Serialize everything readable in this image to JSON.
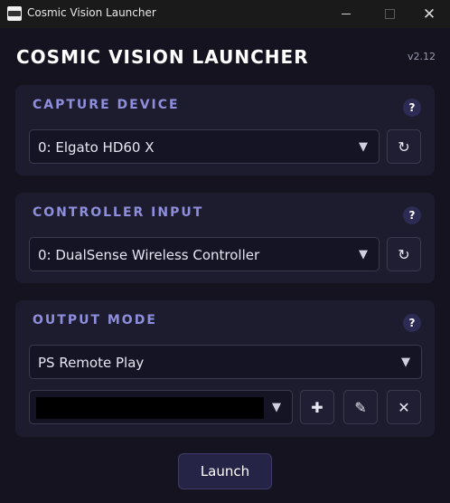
{
  "window": {
    "title": "Cosmic Vision Launcher",
    "minimize": "",
    "maximize": "",
    "close": "✕"
  },
  "header": {
    "title": "COSMIC VISION LAUNCHER",
    "version": "v2.12"
  },
  "capture": {
    "title": "CAPTURE DEVICE",
    "help": "?",
    "selected": "0: Elgato HD60 X",
    "dropdown_arrow": "▼",
    "refresh_icon": "↻"
  },
  "controller": {
    "title": "CONTROLLER INPUT",
    "help": "?",
    "selected": "0: DualSense Wireless Controller",
    "dropdown_arrow": "▼",
    "refresh_icon": "↻"
  },
  "output": {
    "title": "OUTPUT MODE",
    "help": "?",
    "selected": "PS Remote Play",
    "dropdown_arrow": "▼",
    "profile_arrow": "▼",
    "add_icon": "✚",
    "edit_icon": "✎",
    "delete_icon": "✕"
  },
  "launch_label": "Launch"
}
